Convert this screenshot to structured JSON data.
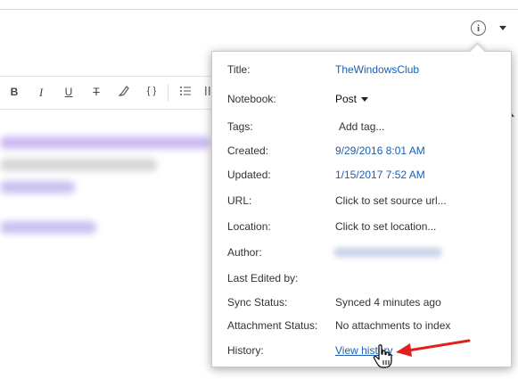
{
  "header": {
    "info_icon": "info-icon",
    "menu_icon": "chevron-down-icon",
    "info_glyph": "i"
  },
  "toolbar": {
    "bold": "B",
    "italic": "I",
    "underline": "U",
    "strikethrough": "T",
    "highlight_icon": "highlighter-icon",
    "code": "{ }",
    "list_icon": "bulleted-list-icon"
  },
  "note_info": {
    "title_label": "Title:",
    "title_value": "TheWindowsClub",
    "notebook_label": "Notebook:",
    "notebook_value": "Post",
    "tags_label": "Tags:",
    "tags_placeholder": "Add tag...",
    "created_label": "Created:",
    "created_value": "9/29/2016 8:01 AM",
    "updated_label": "Updated:",
    "updated_value": "1/15/2017 7:52 AM",
    "url_label": "URL:",
    "url_value": "Click to set source url...",
    "location_label": "Location:",
    "location_value": "Click to set location...",
    "author_label": "Author:",
    "last_edited_label": "Last Edited by:",
    "sync_label": "Sync Status:",
    "sync_value": "Synced 4 minutes ago",
    "attachment_label": "Attachment Status:",
    "attachment_value": "No attachments to index",
    "history_label": "History:",
    "history_value": "View history"
  },
  "colors": {
    "link": "#1a5fb4",
    "annotation_arrow": "#e0201c"
  }
}
